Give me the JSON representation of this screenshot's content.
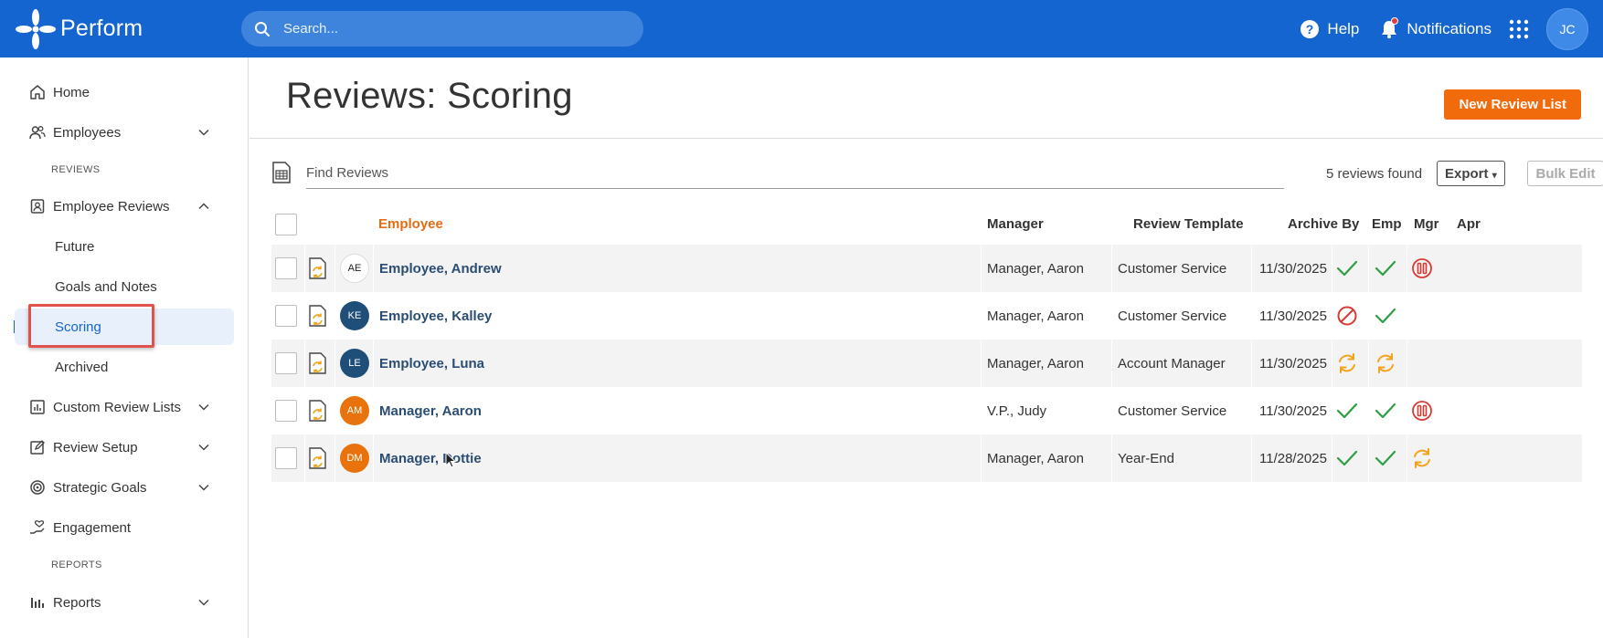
{
  "app": {
    "name": "Perform",
    "search_placeholder": "Search...",
    "help_label": "Help",
    "notifications_label": "Notifications",
    "user_initials": "JC"
  },
  "sidebar": {
    "home": "Home",
    "employees": "Employees",
    "section_reviews": "REVIEWS",
    "employee_reviews": "Employee Reviews",
    "future": "Future",
    "goals_notes": "Goals and Notes",
    "scoring": "Scoring",
    "archived": "Archived",
    "custom_review_lists": "Custom Review Lists",
    "review_setup": "Review Setup",
    "strategic_goals": "Strategic Goals",
    "engagement": "Engagement",
    "section_reports": "REPORTS",
    "reports": "Reports"
  },
  "page": {
    "title": "Reviews: Scoring",
    "new_button": "New Review List",
    "find_placeholder": "Find Reviews",
    "found_text": "5 reviews found",
    "export_label": "Export",
    "bulk_edit_label": "Bulk Edit"
  },
  "table": {
    "columns": {
      "employee": "Employee",
      "manager": "Manager",
      "template": "Review Template",
      "archive_by": "Archive By",
      "emp": "Emp",
      "mgr": "Mgr",
      "apr": "Apr"
    },
    "rows": [
      {
        "initials": "AE",
        "avatar_bg": "#ffffff",
        "avatar_fg": "#222222",
        "name": "Employee, Andrew",
        "manager": "Manager, Aaron",
        "template": "Customer Service",
        "archive_by": "11/30/2025",
        "emp": "check",
        "mgr": "check",
        "apr": "paused"
      },
      {
        "initials": "KE",
        "avatar_bg": "#1f4e79",
        "avatar_fg": "#ffffff",
        "name": "Employee, Kalley",
        "manager": "Manager, Aaron",
        "template": "Customer Service",
        "archive_by": "11/30/2025",
        "emp": "blocked",
        "mgr": "check",
        "apr": ""
      },
      {
        "initials": "LE",
        "avatar_bg": "#1f4e79",
        "avatar_fg": "#ffffff",
        "name": "Employee, Luna",
        "manager": "Manager, Aaron",
        "template": "Account Manager",
        "archive_by": "11/30/2025",
        "emp": "in-progress",
        "mgr": "in-progress",
        "apr": ""
      },
      {
        "initials": "AM",
        "avatar_bg": "#e8720c",
        "avatar_fg": "#ffffff",
        "name": "Manager, Aaron",
        "manager": "V.P., Judy",
        "template": "Customer Service",
        "archive_by": "11/30/2025",
        "emp": "check",
        "mgr": "check",
        "apr": "paused"
      },
      {
        "initials": "DM",
        "avatar_bg": "#e8720c",
        "avatar_fg": "#ffffff",
        "name": "Manager, Dottie",
        "manager": "Manager, Aaron",
        "template": "Year-End",
        "archive_by": "11/28/2025",
        "emp": "check",
        "mgr": "check",
        "apr": "in-progress"
      }
    ]
  },
  "colors": {
    "brand": "#1565d0",
    "accent": "#f16a0b",
    "check": "#2e9e44",
    "blocked": "#d83a34",
    "in_progress": "#f3a21a",
    "highlight": "#e0524c"
  }
}
